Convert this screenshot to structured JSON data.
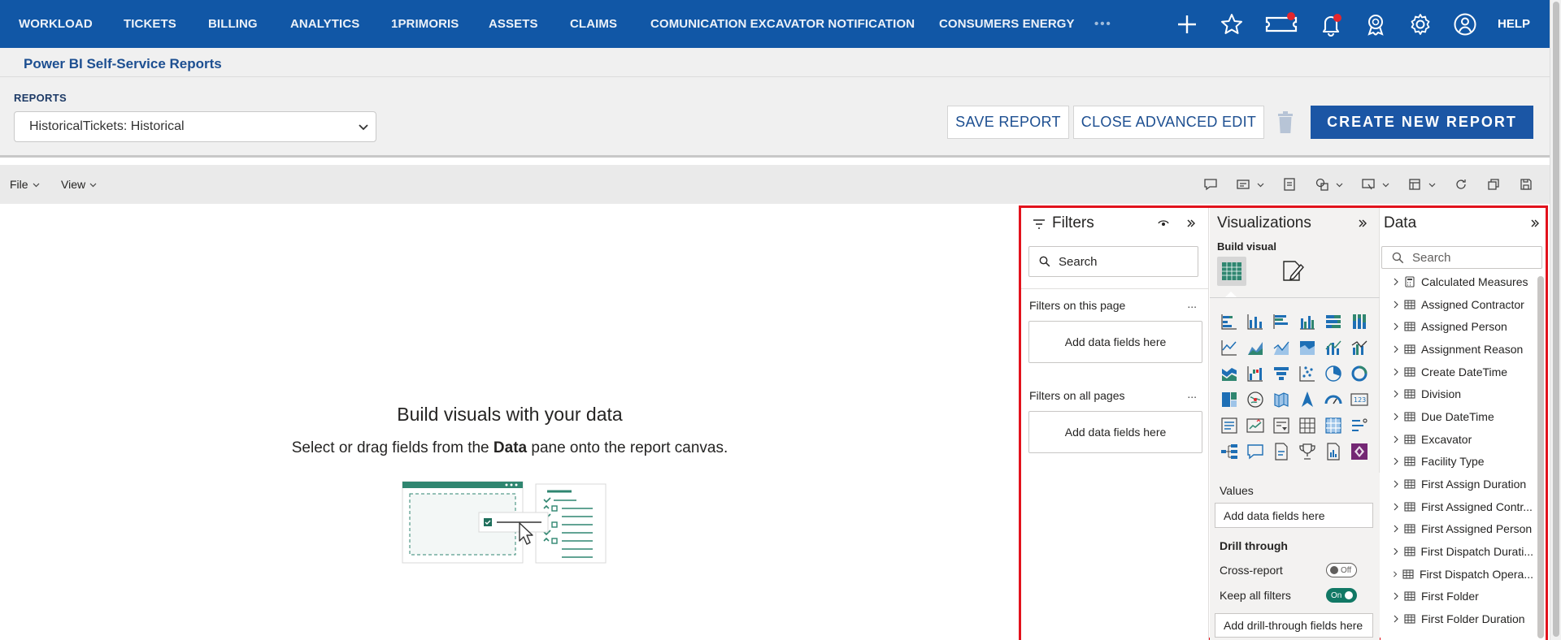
{
  "topnav": {
    "items": [
      "WORKLOAD",
      "TICKETS",
      "BILLING",
      "ANALYTICS",
      "1PRIMORIS",
      "ASSETS",
      "CLAIMS",
      "COMUNICATION EXCAVATOR NOTIFICATION",
      "CONSUMERS ENERGY"
    ],
    "more": "•••",
    "help": "HELP",
    "icons": [
      "plus-icon",
      "star-icon",
      "ticket-icon",
      "bell-icon",
      "award-icon",
      "gear-icon",
      "user-circle-icon"
    ]
  },
  "header": {
    "title": "Power BI Self-Service Reports",
    "reports_label": "REPORTS",
    "selected_report": "HistoricalTickets: Historical",
    "save_report": "SAVE REPORT",
    "close_advanced_edit": "CLOSE ADVANCED EDIT",
    "create_new_report": "CREATE NEW REPORT"
  },
  "toolbar": {
    "file": "File",
    "view": "View"
  },
  "canvas": {
    "empty_title": "Build visuals with your data",
    "empty_sub_prefix": "Select or drag fields from the ",
    "empty_sub_bold": "Data",
    "empty_sub_suffix": " pane onto the report canvas."
  },
  "filters": {
    "title": "Filters",
    "search_placeholder": "Search",
    "on_this_page": "Filters on this page",
    "on_all_pages": "Filters on all pages",
    "add_fields": "Add data fields here",
    "more": "..."
  },
  "visualizations": {
    "title": "Visualizations",
    "build_visual": "Build visual",
    "values": "Values",
    "values_well": "Add data fields here",
    "drill_through": "Drill through",
    "cross_report": "Cross-report",
    "cross_report_state": "Off",
    "keep_all_filters": "Keep all filters",
    "keep_all_filters_state": "On",
    "drill_well": "Add drill-through fields here"
  },
  "data": {
    "title": "Data",
    "search_placeholder": "Search",
    "items": [
      "Calculated Measures",
      "Assigned Contractor",
      "Assigned Person",
      "Assignment Reason",
      "Create DateTime",
      "Division",
      "Due DateTime",
      "Excavator",
      "Facility Type",
      "First Assign Duration",
      "First Assigned Contr...",
      "First Assigned Person",
      "First Dispatch Durati...",
      "First Dispatch Opera...",
      "First Folder",
      "First Folder Duration"
    ]
  },
  "colors": {
    "nav_bg": "#1157a6",
    "accent": "#1b56a5",
    "outline": "#e2121c",
    "toggle_on": "#117865"
  }
}
